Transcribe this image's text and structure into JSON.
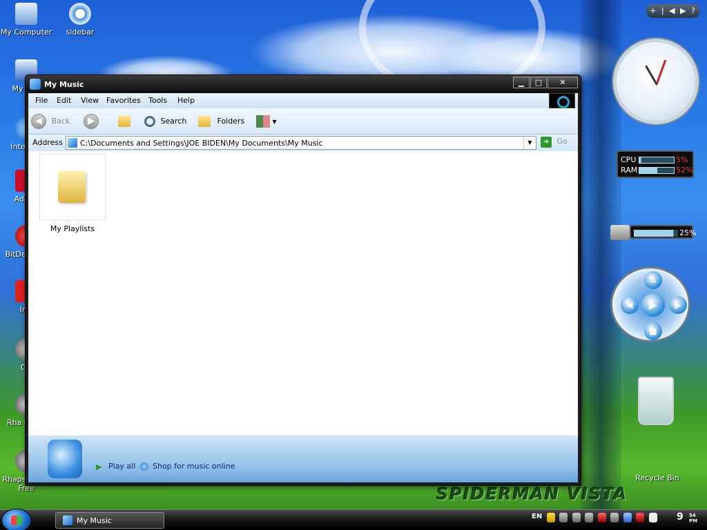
{
  "desktop": {
    "icons": [
      {
        "label": "My Computer",
        "icon": "computer-icon"
      },
      {
        "label": "sidebar",
        "icon": "gear-icon"
      },
      {
        "label": "My N Pl",
        "icon": "media-player-icon"
      },
      {
        "label": "Inte Exp",
        "icon": "internet-explorer-icon"
      },
      {
        "label": "Adobe",
        "icon": "adobe-icon"
      },
      {
        "label": "BitDef Free",
        "icon": "bitdefender-icon"
      },
      {
        "label": "Irfa",
        "icon": "irfanview-icon"
      },
      {
        "label": "Op",
        "icon": "opera-icon"
      },
      {
        "label": "Rha Music",
        "icon": "rhapsody-icon"
      },
      {
        "label": "Rhaps Music Free",
        "icon": "rhapsody-icon"
      }
    ],
    "wallpaper_text": "SPIDERMAN VISTA",
    "recycle_bin_label": "Recycle Bin"
  },
  "window": {
    "title": "My Music",
    "controls": {
      "minimize": "▁",
      "maximize": "□",
      "close": "✕"
    },
    "menu": [
      "File",
      "Edit",
      "View",
      "Favorites",
      "Tools",
      "Help"
    ],
    "toolbar": {
      "back": "Back",
      "search": "Search",
      "folders": "Folders"
    },
    "address": {
      "label": "Address",
      "path": "C:\\Documents and Settings\\JOE BIDEN\\My Documents\\My Music",
      "go": "Go"
    },
    "items": [
      {
        "label": "My Playlists",
        "icon": "folder-icon"
      }
    ],
    "tasks": {
      "play_all": "Play all",
      "shop": "Shop for music online"
    }
  },
  "gadgets": {
    "cpu_label": "CPU",
    "cpu_pct": "5%",
    "cpu_level": 0.05,
    "ram_label": "RAM",
    "ram_pct": "52%",
    "ram_level": 0.52,
    "disk_pct": "25%",
    "disk_level": 0.25,
    "topbar": "+ | ◀ ▶ ?"
  },
  "taskbar": {
    "task_label": "My Music",
    "lang": "EN",
    "time": "9",
    "time_small": "54 PM"
  }
}
